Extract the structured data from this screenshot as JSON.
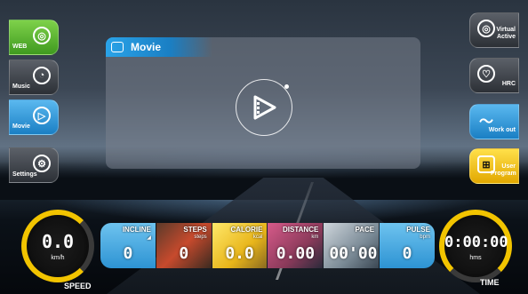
{
  "left_menu": [
    {
      "label": "WEB",
      "icon": "globe-icon",
      "style": "green"
    },
    {
      "label": "Music",
      "icon": "music-disc-icon",
      "style": "grey"
    },
    {
      "label": "Movie",
      "icon": "movie-icon",
      "style": "blue"
    },
    {
      "label": "Settings",
      "icon": "settings-user-icon",
      "style": "grey"
    }
  ],
  "right_menu": [
    {
      "label": "Virtual Active",
      "icon": "virtual-active-icon",
      "style": "grey"
    },
    {
      "label": "HRC",
      "icon": "heart-rate-icon",
      "style": "grey"
    },
    {
      "label": "Work out",
      "icon": "workout-wave-icon",
      "style": "blue"
    },
    {
      "label": "User Program",
      "icon": "user-program-icon",
      "style": "yellow"
    }
  ],
  "panel": {
    "title": "Movie",
    "center_icon": "movie-play-icon"
  },
  "speed": {
    "value": "0.0",
    "unit": "km/h",
    "label": "SPEED"
  },
  "time": {
    "value": "0:00:00",
    "unit": "hms",
    "label": "TIME"
  },
  "tiles": [
    {
      "label": "INCLINE",
      "unit": "",
      "value": "0",
      "style": "blue"
    },
    {
      "label": "STEPS",
      "unit": "steps",
      "value": "0",
      "style": "photo-red"
    },
    {
      "label": "CALORIE",
      "unit": "kcal",
      "value": "0.0",
      "style": "photo-yellow"
    },
    {
      "label": "DISTANCE",
      "unit": "km",
      "value": "0.00",
      "style": "photo-pink"
    },
    {
      "label": "PACE",
      "unit": "",
      "value": "00'00\"",
      "style": "photo-grey"
    },
    {
      "label": "PULSE",
      "unit": "bpm",
      "value": "0",
      "style": "blue"
    }
  ],
  "colors": {
    "accent_blue": "#2a9fe3",
    "accent_green": "#5bb82e",
    "accent_yellow": "#f2c400"
  }
}
